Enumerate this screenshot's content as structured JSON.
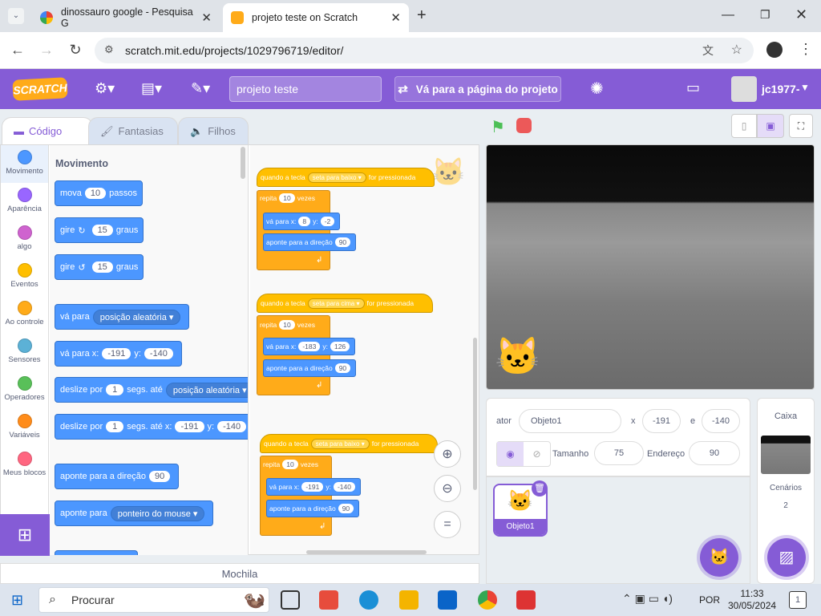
{
  "browser": {
    "tabs": [
      {
        "title": "dinossauro google - Pesquisa G",
        "close": "✕"
      },
      {
        "title": "projeto teste on Scratch",
        "close": "✕"
      }
    ],
    "new_tab": "+",
    "url": "scratch.mit.edu/projects/1029796719/editor/"
  },
  "menubar": {
    "logo": "SCRATCH",
    "project_title": "projeto teste",
    "see_project": "Vá para a página do projeto",
    "username": "jc1977-"
  },
  "editor_tabs": [
    "Código",
    "Fantasias",
    "Filhos"
  ],
  "categories": [
    {
      "label": "Movimento",
      "color": "#4c97ff"
    },
    {
      "label": "Aparência",
      "color": "#9966ff"
    },
    {
      "label": "algo",
      "color": "#cf63cf"
    },
    {
      "label": "Eventos",
      "color": "#ffbf00"
    },
    {
      "label": "Ao controle",
      "color": "#ffab19"
    },
    {
      "label": "Sensores",
      "color": "#5cb1d6"
    },
    {
      "label": "Operadores",
      "color": "#59c059"
    },
    {
      "label": "Variáveis",
      "color": "#ff8c1a"
    },
    {
      "label": "Meus blocos",
      "color": "#ff6680"
    }
  ],
  "palette": {
    "heading": "Movimento",
    "move": {
      "a": "mova",
      "v": "10",
      "b": "passos"
    },
    "turn_right": {
      "a": "gire",
      "v": "15",
      "b": "graus"
    },
    "turn_left": {
      "a": "gire",
      "v": "15",
      "b": "graus"
    },
    "goto": {
      "a": "vá para",
      "d": "posição aleatória"
    },
    "gotoxy": {
      "a": "vá para x:",
      "x": "-191",
      "yl": "y:",
      "y": "-140"
    },
    "glide1": {
      "a": "deslize por",
      "v": "1",
      "b": "segs. até",
      "d": "posição aleatória"
    },
    "glide2": {
      "a": "deslize por",
      "v": "1",
      "b": "segs. até x:",
      "x": "-191",
      "yl": "y:",
      "y": "-140"
    },
    "point_dir": {
      "a": "aponte para a direção",
      "v": "90"
    },
    "point_to": {
      "a": "aponte para",
      "d": "ponteiro do mouse"
    }
  },
  "scripts": [
    {
      "hat_a": "quando a tecla",
      "key": "seta para baixo",
      "hat_b": "for pressionada",
      "repeat": "repita",
      "times": "10",
      "vezes": "vezes",
      "goto_a": "vá para x:",
      "x": "8",
      "yl": "y:",
      "y": "-2",
      "point_a": "aponte para a direção",
      "dir": "90"
    },
    {
      "hat_a": "quando a tecla",
      "key": "seta para cima",
      "hat_b": "for pressionada",
      "repeat": "repita",
      "times": "10",
      "vezes": "vezes",
      "goto_a": "vá para x:",
      "x": "-183",
      "yl": "y:",
      "y": "126",
      "point_a": "aponte para a direção",
      "dir": "90"
    },
    {
      "hat_a": "quando a tecla",
      "key": "seta para baixo",
      "hat_b": "for pressionada",
      "repeat": "repita",
      "times": "10",
      "vezes": "vezes",
      "goto_a": "vá para x:",
      "x": "-191",
      "yl": "y:",
      "y": "-140",
      "point_a": "aponte para a direção",
      "dir": "90"
    }
  ],
  "zoom": {
    "in": "+",
    "out": "−",
    "reset": "="
  },
  "sprite_info": {
    "label_sprite": "ator",
    "name": "Objeto1",
    "x_label": "x",
    "x": "-191",
    "y_label": "e",
    "y": "-140",
    "size_label": "Tamanho",
    "size": "75",
    "dir_label": "Endereço",
    "dir": "90"
  },
  "sprite_list": [
    {
      "name": "Objeto1"
    }
  ],
  "stage_panel": {
    "title": "Caixa",
    "backdrops_label": "Cenários",
    "backdrops_count": "2"
  },
  "backpack": "Mochila",
  "taskbar": {
    "search": "Procurar",
    "lang": "POR",
    "time": "11:33",
    "date": "30/05/2024",
    "notif": "1"
  }
}
